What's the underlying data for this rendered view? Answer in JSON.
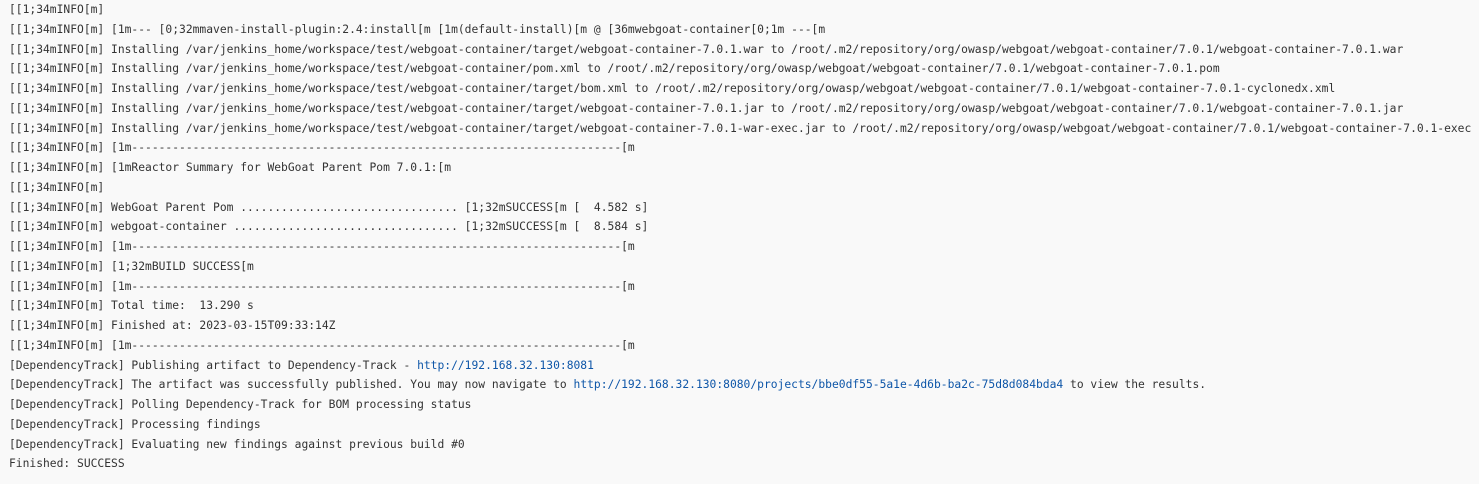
{
  "console": {
    "lines": [
      {
        "text": "[[1;34mINFO[m]"
      },
      {
        "text": "[[1;34mINFO[m] [1m--- [0;32mmaven-install-plugin:2.4:install[m [1m(default-install)[m @ [36mwebgoat-container[0;1m ---[m"
      },
      {
        "text": "[[1;34mINFO[m] Installing /var/jenkins_home/workspace/test/webgoat-container/target/webgoat-container-7.0.1.war to /root/.m2/repository/org/owasp/webgoat/webgoat-container/7.0.1/webgoat-container-7.0.1.war"
      },
      {
        "text": "[[1;34mINFO[m] Installing /var/jenkins_home/workspace/test/webgoat-container/pom.xml to /root/.m2/repository/org/owasp/webgoat/webgoat-container/7.0.1/webgoat-container-7.0.1.pom"
      },
      {
        "text": "[[1;34mINFO[m] Installing /var/jenkins_home/workspace/test/webgoat-container/target/bom.xml to /root/.m2/repository/org/owasp/webgoat/webgoat-container/7.0.1/webgoat-container-7.0.1-cyclonedx.xml"
      },
      {
        "text": "[[1;34mINFO[m] Installing /var/jenkins_home/workspace/test/webgoat-container/target/webgoat-container-7.0.1.jar to /root/.m2/repository/org/owasp/webgoat/webgoat-container/7.0.1/webgoat-container-7.0.1.jar"
      },
      {
        "text": "[[1;34mINFO[m] Installing /var/jenkins_home/workspace/test/webgoat-container/target/webgoat-container-7.0.1-war-exec.jar to /root/.m2/repository/org/owasp/webgoat/webgoat-container/7.0.1/webgoat-container-7.0.1-exec"
      },
      {
        "text": "[[1;34mINFO[m] [1m------------------------------------------------------------------------[m"
      },
      {
        "text": "[[1;34mINFO[m] [1mReactor Summary for WebGoat Parent Pom 7.0.1:[m"
      },
      {
        "text": "[[1;34mINFO[m]"
      },
      {
        "text": "[[1;34mINFO[m] WebGoat Parent Pom ................................ [1;32mSUCCESS[m [  4.582 s]"
      },
      {
        "text": "[[1;34mINFO[m] webgoat-container ................................. [1;32mSUCCESS[m [  8.584 s]"
      },
      {
        "text": "[[1;34mINFO[m] [1m------------------------------------------------------------------------[m"
      },
      {
        "text": "[[1;34mINFO[m] [1;32mBUILD SUCCESS[m"
      },
      {
        "text": "[[1;34mINFO[m] [1m------------------------------------------------------------------------[m"
      },
      {
        "text": "[[1;34mINFO[m] Total time:  13.290 s"
      },
      {
        "text": "[[1;34mINFO[m] Finished at: 2023-03-15T09:33:14Z"
      },
      {
        "text": "[[1;34mINFO[m] [1m------------------------------------------------------------------------[m"
      },
      {
        "text": "[DependencyTrack] Publishing artifact to Dependency-Track - ",
        "link": "http://192.168.32.130:8081",
        "after": ""
      },
      {
        "text": "[DependencyTrack] The artifact was successfully published. You may now navigate to ",
        "link": "http://192.168.32.130:8080/projects/bbe0df55-5a1e-4d6b-ba2c-75d8d084bda4",
        "after": " to view the results."
      },
      {
        "text": "[DependencyTrack] Polling Dependency-Track for BOM processing status"
      },
      {
        "text": "[DependencyTrack] Processing findings"
      },
      {
        "text": "[DependencyTrack] Evaluating new findings against previous build #0"
      },
      {
        "text": "Finished: SUCCESS"
      }
    ]
  },
  "colors": {
    "background": "#f9f9f9",
    "text": "#333333",
    "link": "#0e56a8"
  }
}
